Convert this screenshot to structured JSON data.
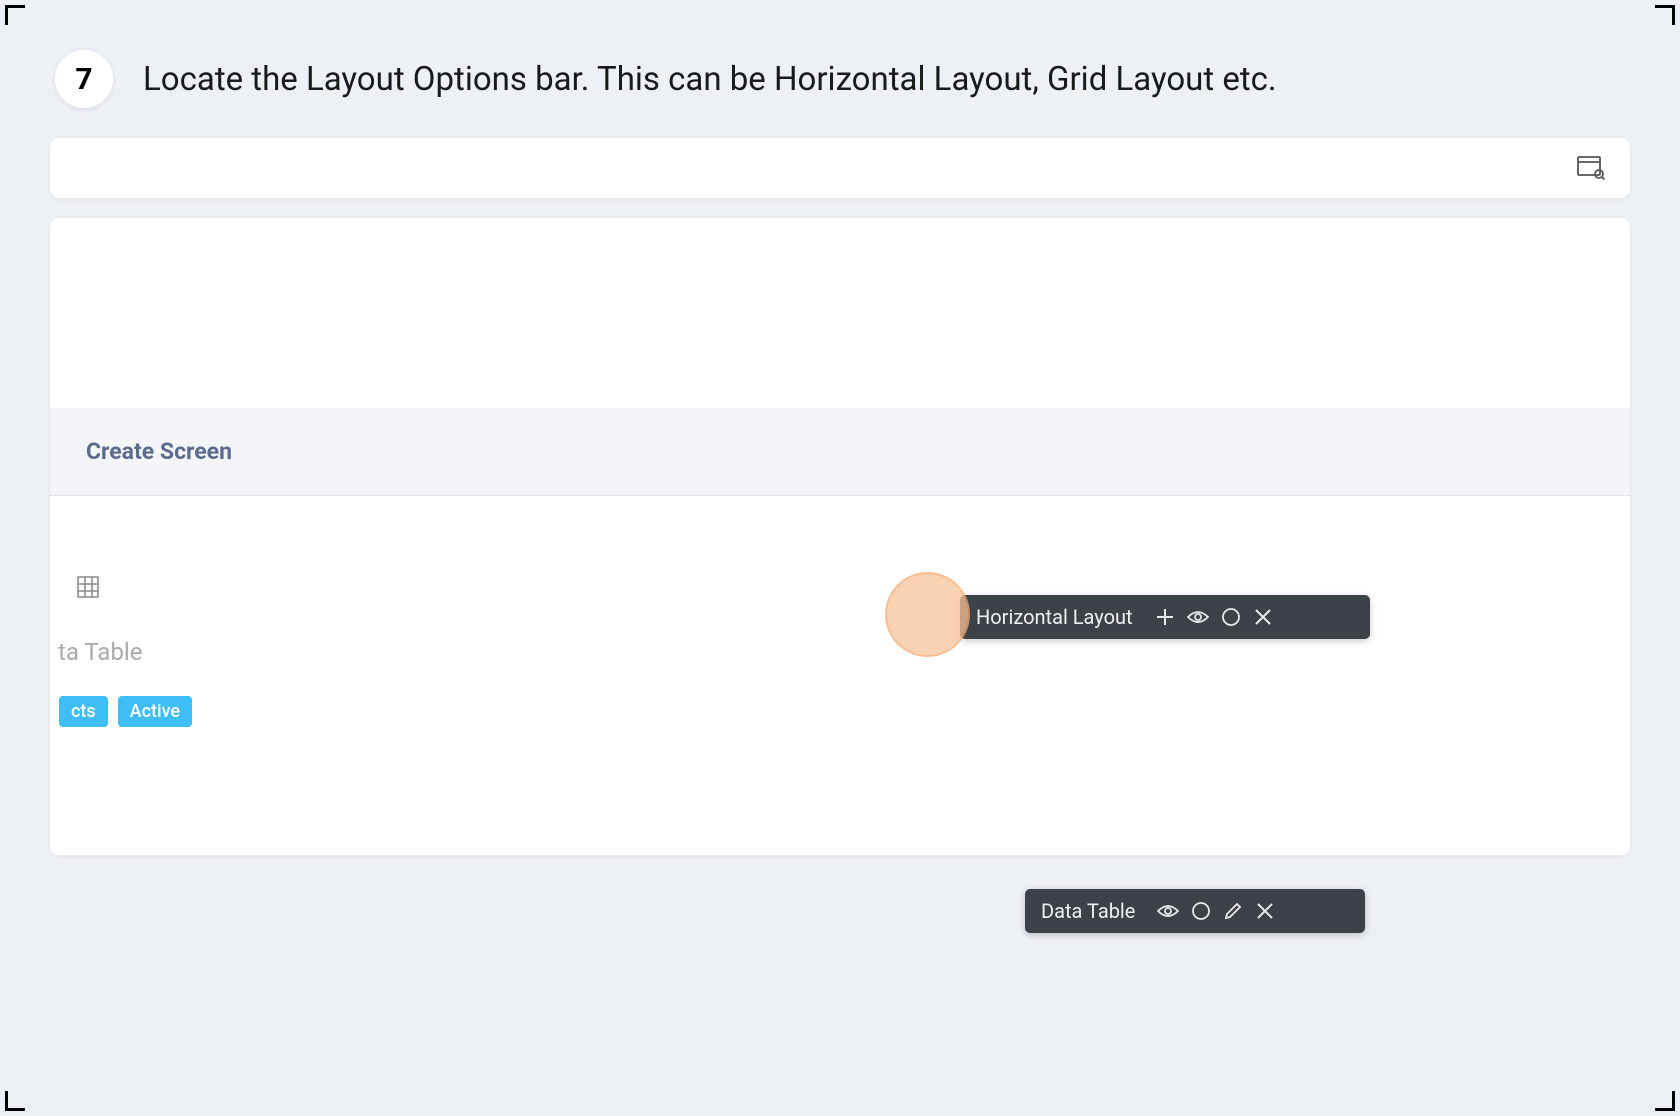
{
  "step": {
    "number": "7",
    "text": "Locate the Layout Options bar. This can be Horizontal Layout, Grid Layout etc."
  },
  "section": {
    "title": "Create Screen"
  },
  "canvas": {
    "table_label_partial": "ta Table",
    "tags": [
      "cts",
      "Active"
    ]
  },
  "layout_bar": {
    "label": "Horizontal Layout"
  },
  "datatable_bar": {
    "label": "Data Table"
  }
}
